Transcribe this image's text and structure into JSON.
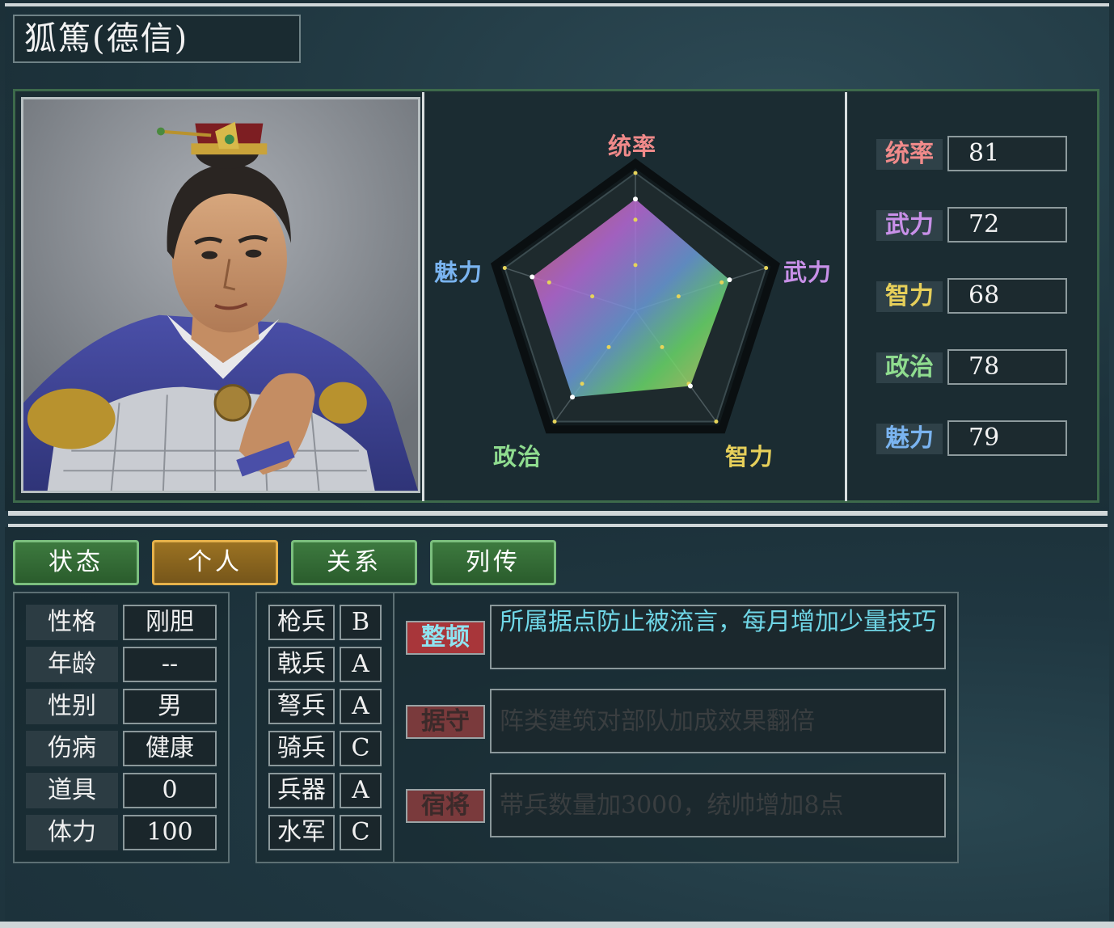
{
  "officer": {
    "name": "狐篤(德信)"
  },
  "radar": {
    "labels": {
      "command": "统率",
      "war": "武力",
      "intelligence": "智力",
      "politics": "政治",
      "charisma": "魅力"
    },
    "colors": {
      "command": "#f08a8a",
      "war": "#c890e8",
      "intelligence": "#e6cf5a",
      "politics": "#8fdc8f",
      "charisma": "#7ab4f0"
    },
    "values": [
      81,
      72,
      68,
      78,
      79
    ],
    "max": 100
  },
  "stats": [
    {
      "label": "统率",
      "value": "81",
      "color": "#f08a8a"
    },
    {
      "label": "武力",
      "value": "72",
      "color": "#c890e8"
    },
    {
      "label": "智力",
      "value": "68",
      "color": "#e6cf5a"
    },
    {
      "label": "政治",
      "value": "78",
      "color": "#8fdc8f"
    },
    {
      "label": "魅力",
      "value": "79",
      "color": "#7ab4f0"
    }
  ],
  "tabs": [
    {
      "label": "状态",
      "active": false
    },
    {
      "label": "个人",
      "active": true
    },
    {
      "label": "关系",
      "active": false
    },
    {
      "label": "列传",
      "active": false
    }
  ],
  "info": [
    {
      "label": "性格",
      "value": "刚胆"
    },
    {
      "label": "年龄",
      "value": "--"
    },
    {
      "label": "性别",
      "value": "男"
    },
    {
      "label": "伤病",
      "value": "健康"
    },
    {
      "label": "道具",
      "value": "0"
    },
    {
      "label": "体力",
      "value": "100"
    }
  ],
  "troops": [
    {
      "label": "枪兵",
      "grade": "B"
    },
    {
      "label": "戟兵",
      "grade": "A"
    },
    {
      "label": "弩兵",
      "grade": "A"
    },
    {
      "label": "骑兵",
      "grade": "C"
    },
    {
      "label": "兵器",
      "grade": "A"
    },
    {
      "label": "水军",
      "grade": "C"
    }
  ],
  "skills": [
    {
      "name": "整顿",
      "desc": "所属据点防止被流言，每月增加少量技巧",
      "active": true
    },
    {
      "name": "据守",
      "desc": "阵类建筑对部队加成效果翻倍",
      "active": false
    },
    {
      "name": "宿将",
      "desc": "带兵数量加3000，统帅增加8点",
      "active": false
    }
  ]
}
